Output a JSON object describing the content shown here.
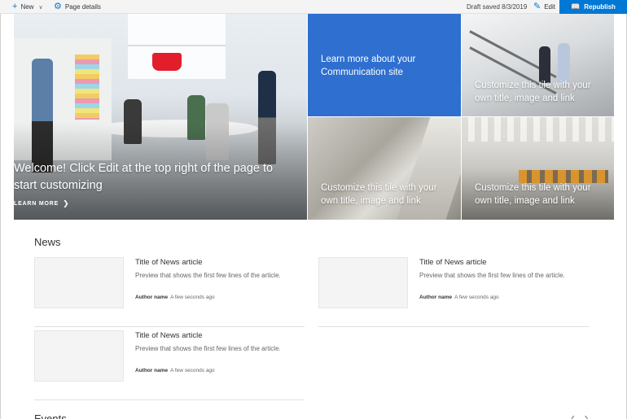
{
  "commandbar": {
    "new_label": "New",
    "page_details_label": "Page details",
    "status": "Draft saved 8/3/2019",
    "edit_label": "Edit",
    "republish_label": "Republish"
  },
  "icons": {
    "new": "plus-icon",
    "page_details": "gear-icon",
    "edit": "pencil-icon",
    "republish": "book-icon"
  },
  "colors": {
    "accent": "#0078d4",
    "tile_blue": "#2e6fd0"
  },
  "hero": {
    "main_title": "Welcome! Click Edit at the top right of the page to start customizing",
    "learn_more": "LEARN MORE",
    "tiles": [
      {
        "caption": "Learn more about your Communication site"
      },
      {
        "caption": "Customize this tile with your own title, image and link"
      },
      {
        "caption": "Customize this tile with your own title, image and link"
      },
      {
        "caption": "Customize this tile with your own title, image and link"
      }
    ]
  },
  "news": {
    "title": "News",
    "articles": [
      {
        "title": "Title of News article",
        "preview": "Preview that shows the first few lines of the article.",
        "author": "Author name",
        "time": "A few seconds ago"
      },
      {
        "title": "Title of News article",
        "preview": "Preview that shows the first few lines of the article.",
        "author": "Author name",
        "time": "A few seconds ago"
      },
      {
        "title": "Title of News article",
        "preview": "Preview that shows the first few lines of the article.",
        "author": "Author name",
        "time": "A few seconds ago"
      }
    ]
  },
  "events": {
    "title": "Events"
  }
}
